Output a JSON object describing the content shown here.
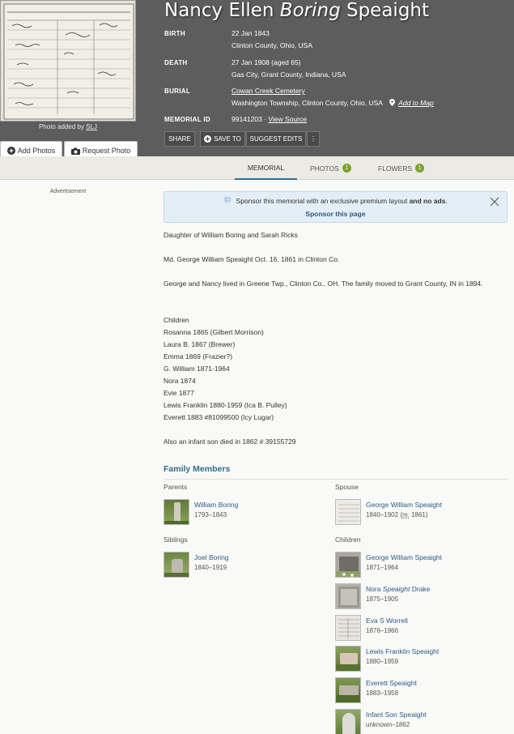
{
  "memorial": {
    "first_names": "Nancy Ellen",
    "maiden_name": "Boring",
    "last_name": "Speaight",
    "photo_added_prefix": "Photo added by",
    "photo_added_by": "SLJ",
    "add_photos_label": "Add Photos",
    "request_photo_label": "Request Photo",
    "birth_label": "BIRTH",
    "birth_date": "22 Jan 1843",
    "birth_place": "Clinton County, Ohio, USA",
    "death_label": "DEATH",
    "death_date": "27 Jan 1908 (aged 65)",
    "death_place": "Gas City, Grant County, Indiana, USA",
    "burial_label": "BURIAL",
    "burial_cemetery": "Cowan Creek Cemetery",
    "burial_place": "Washington Township, Clinton County, Ohio, USA",
    "add_to_map": "Add to Map",
    "memorial_id_label": "MEMORIAL ID",
    "memorial_id": "99141203 ·",
    "view_source": "View Source",
    "share_label": "SHARE",
    "save_to_label": "SAVE TO",
    "suggest_edits_label": "SUGGEST EDITS",
    "more_label": "⋮"
  },
  "tabs": {
    "memorial": "MEMORIAL",
    "photos": "PHOTOS",
    "photos_count": "1",
    "flowers": "FLOWERS",
    "flowers_count": "1"
  },
  "advertisement": "Advertisement",
  "banner": {
    "text": "Sponsor this memorial with an exclusive premium layout",
    "and": "and no ads",
    "period": ".",
    "link": "Sponsor this page"
  },
  "bio": [
    "Daughter of William Boring and Sarah Ricks",
    "Md. George William Speaight Oct. 16, 1861 in Clinton Co.",
    "George and Nancy lived in Greene Twp., Clinton Co., OH. The family moved to Grant County, IN in 1894.",
    "Children",
    "Rosanna 1865 (Gilbert Morrison)",
    "Laura B. 1867 (Brewer)",
    "Emma 1869 (Frazier?)",
    "G. William 1871-1964",
    "Nora 1874",
    "Evie 1877",
    "Lewis Franklin 1880-1959 (Ica B. Pulley)",
    "Everett 1883 #81099500 (Icy Lugar)",
    "Also an infant son died in 1862 # 39155729"
  ],
  "family": {
    "title": "Family Members",
    "parents_label": "Parents",
    "spouse_label": "Spouse",
    "siblings_label": "Siblings",
    "children_label": "Children",
    "parents": [
      {
        "name": "William Boring",
        "dates": "1793–1843"
      }
    ],
    "spouse": [
      {
        "name": "George William Speaight",
        "dates_prefix": "1840–1902 (",
        "married_abbr": "m.",
        "dates_suffix": " 1861)"
      }
    ],
    "siblings": [
      {
        "name": "Joel Boring",
        "dates": "1840–1919"
      }
    ],
    "children": [
      {
        "name": "George William Speaight",
        "dates": "1871–1964"
      },
      {
        "name_first": "Nora ",
        "name_maiden": "Speaight",
        "name_last": " Drake",
        "dates": "1875–1905"
      },
      {
        "name": "Eva S Worrell",
        "dates": "1876–1966"
      },
      {
        "name": "Lewis Franklin Speaight",
        "dates": "1880–1959"
      },
      {
        "name": "Everett Speaight",
        "dates": "1883–1958"
      },
      {
        "name": "Infant Son Speaight",
        "dates": "unknown–1862"
      }
    ]
  },
  "colors": {
    "header_bg": "#5d5d5d",
    "link": "#2a5b84",
    "accent": "#2f6e8e",
    "badge": "#7aa331"
  }
}
